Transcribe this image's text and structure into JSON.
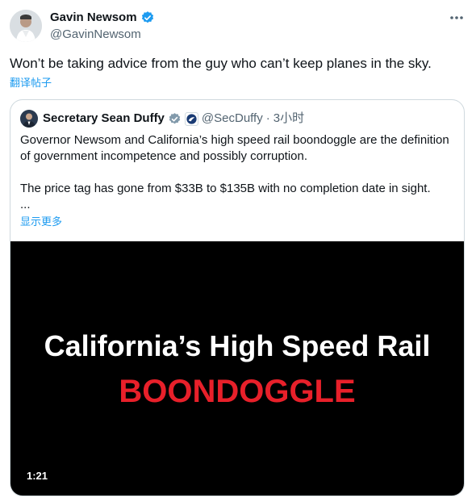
{
  "author": {
    "name": "Gavin Newsom",
    "handle": "@GavinNewsom"
  },
  "tweet": {
    "text": "Won’t be taking advice from the guy who can’t keep planes in the sky.",
    "translate_label": "翻译帖子"
  },
  "quote": {
    "name": "Secretary Sean Duffy",
    "handle": "@SecDuffy",
    "separator": "·",
    "time": "3小时",
    "paragraph1": "Governor Newsom and California’s high speed rail boondoggle are the definition of government incompetence and possibly corruption.",
    "paragraph2": "The price tag has gone from $33B to $135B with no completion date in sight.",
    "ellipsis": "...",
    "show_more_label": "显示更多",
    "video": {
      "title": "California’s High Speed Rail",
      "subtitle": "BOONDOGGLE",
      "duration": "1:21"
    }
  },
  "icons": {
    "verified": "verified-badge-icon",
    "more": "more-options-icon",
    "affiliation": "dot-seal-icon"
  },
  "colors": {
    "accent": "#1d9bf0",
    "secondary_text": "#536471",
    "video_subtitle": "#e8202a"
  }
}
